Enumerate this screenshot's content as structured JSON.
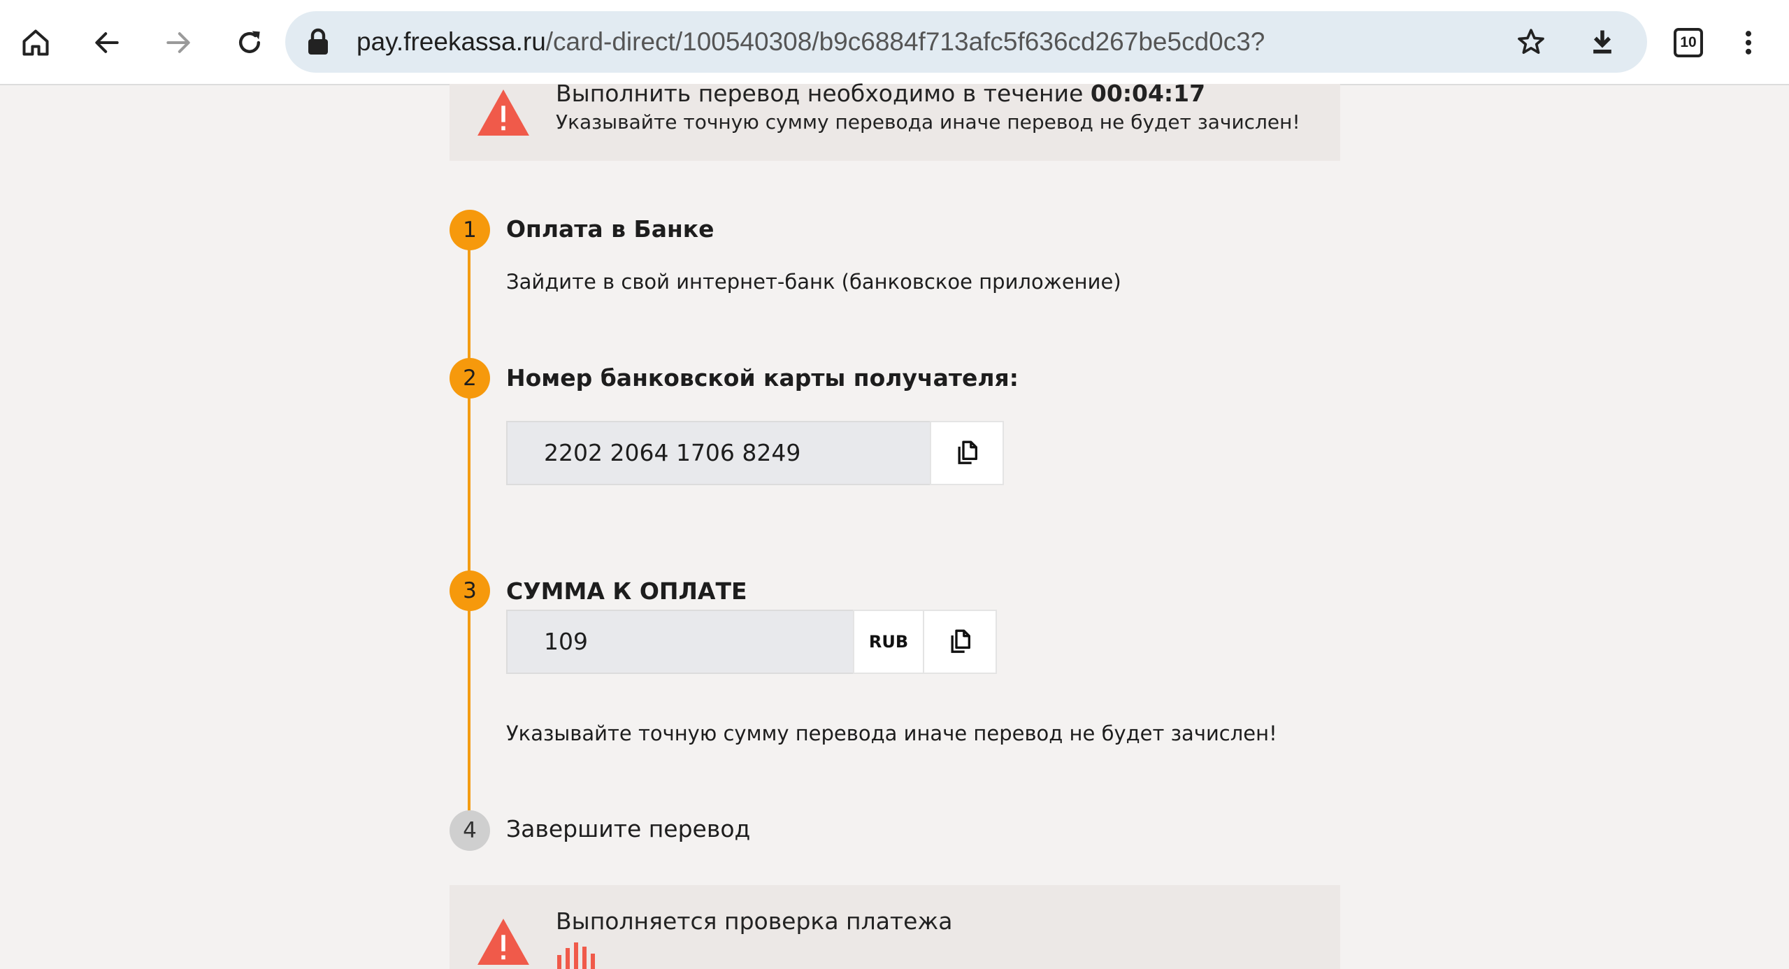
{
  "browser": {
    "url_host": "pay.freekassa.ru",
    "url_path": "/card-direct/100540308/b9c6884f713afc5f636cd267be5cd0c3?",
    "tab_count": "10",
    "icons": [
      "home-icon",
      "back-icon",
      "forward-icon",
      "reload-icon",
      "lock-icon",
      "star-icon",
      "download-icon",
      "tabs-icon",
      "more-icon"
    ]
  },
  "timer_alert": {
    "line1": "Выполнить перевод необходимо в течение",
    "timer": "00:04:17",
    "line2": "Указывайте точную сумму перевода иначе перевод не будет зачислен!"
  },
  "steps": [
    {
      "number": "1",
      "title": "Оплата в Банке",
      "text": "Зайдите в свой интернет-банк (банковское приложение)"
    },
    {
      "number": "2",
      "title": "Номер банковской карты получателя:",
      "card_number": "2202 2064 1706 8249"
    },
    {
      "number": "3",
      "title": "СУММА К ОПЛАТЕ",
      "amount": "109",
      "currency": "RUB",
      "note": "Указывайте точную сумму перевода иначе перевод не будет зачислен!"
    },
    {
      "number": "4",
      "title": "Завершите перевод"
    }
  ],
  "status_alert": {
    "line1": "Выполняется проверка платежа"
  },
  "colors": {
    "accent": "#f6990c",
    "warning": "#f05a4a",
    "pending": "#cfcfcf"
  }
}
